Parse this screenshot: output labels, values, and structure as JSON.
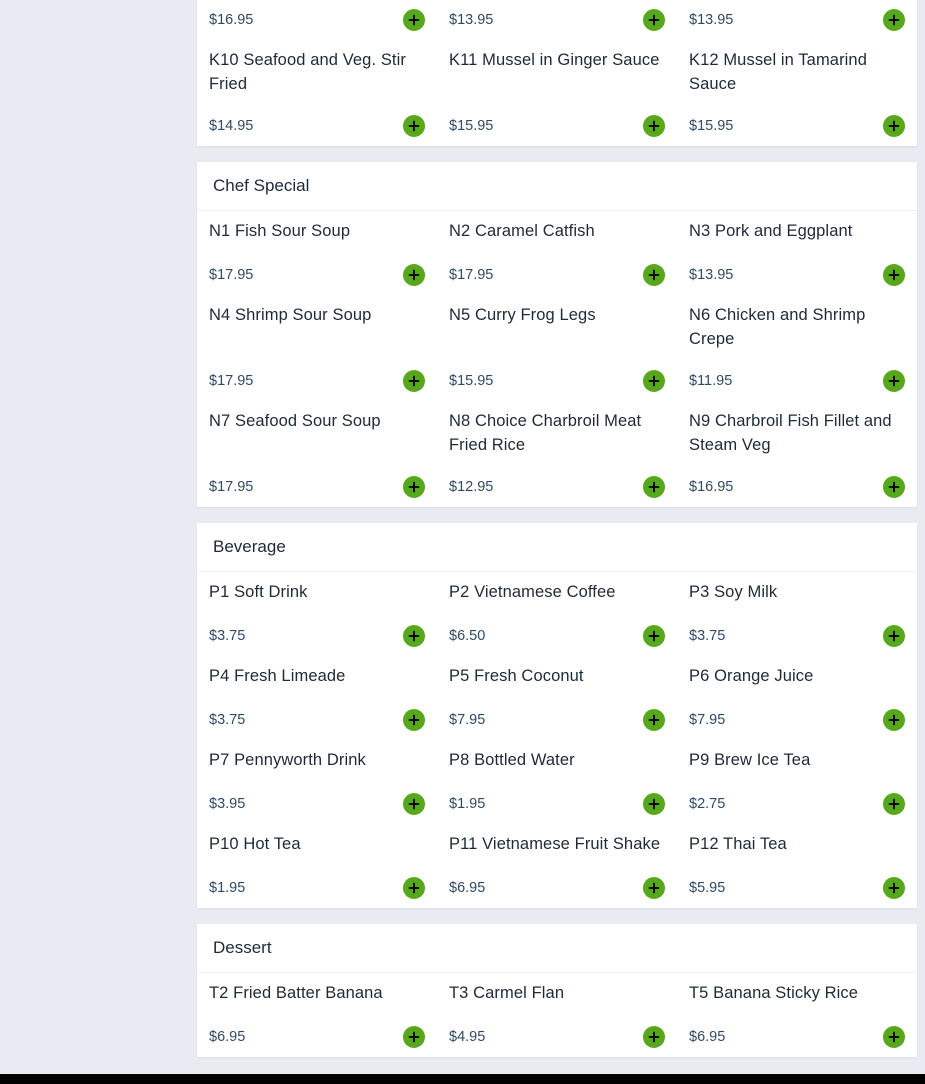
{
  "colors": {
    "accent": "#58a81c",
    "background": "#e8ebf1",
    "text": "#1e2a36",
    "price": "#2f4a66"
  },
  "top_partial": {
    "rows": [
      [
        {
          "price": "$16.95"
        },
        {
          "price": "$13.95"
        },
        {
          "price": "$13.95"
        }
      ],
      [
        {
          "name": "K10 Seafood and Veg. Stir Fried",
          "price": "$14.95"
        },
        {
          "name": "K11 Mussel in Ginger Sauce",
          "price": "$15.95"
        },
        {
          "name": "K12 Mussel in Tamarind Sauce",
          "price": "$15.95"
        }
      ]
    ]
  },
  "sections": [
    {
      "title": "Chef Special",
      "items": [
        {
          "name": "N1 Fish Sour Soup",
          "price": "$17.95"
        },
        {
          "name": "N2 Caramel Catfish",
          "price": "$17.95"
        },
        {
          "name": "N3 Pork and Eggplant",
          "price": "$13.95"
        },
        {
          "name": "N4 Shrimp Sour Soup",
          "price": "$17.95"
        },
        {
          "name": "N5 Curry Frog Legs",
          "price": "$15.95"
        },
        {
          "name": "N6 Chicken and Shrimp Crepe",
          "price": "$11.95"
        },
        {
          "name": "N7 Seafood Sour Soup",
          "price": "$17.95"
        },
        {
          "name": "N8 Choice Charbroil Meat Fried Rice",
          "price": "$12.95"
        },
        {
          "name": "N9 Charbroil Fish Fillet and Steam Veg",
          "price": "$16.95"
        }
      ]
    },
    {
      "title": "Beverage",
      "items": [
        {
          "name": "P1 Soft Drink",
          "price": "$3.75"
        },
        {
          "name": "P2 Vietnamese Coffee",
          "price": "$6.50"
        },
        {
          "name": "P3 Soy Milk",
          "price": "$3.75"
        },
        {
          "name": "P4 Fresh Limeade",
          "price": "$3.75"
        },
        {
          "name": "P5 Fresh Coconut",
          "price": "$7.95"
        },
        {
          "name": "P6 Orange Juice",
          "price": "$7.95"
        },
        {
          "name": "P7 Pennyworth Drink",
          "price": "$3.95"
        },
        {
          "name": "P8 Bottled Water",
          "price": "$1.95"
        },
        {
          "name": "P9 Brew Ice Tea",
          "price": "$2.75"
        },
        {
          "name": "P10 Hot Tea",
          "price": "$1.95"
        },
        {
          "name": "P11 Vietnamese Fruit Shake",
          "price": "$6.95"
        },
        {
          "name": "P12 Thai Tea",
          "price": "$5.95"
        }
      ]
    },
    {
      "title": "Dessert",
      "items": [
        {
          "name": "T2 Fried Batter Banana",
          "price": "$6.95"
        },
        {
          "name": "T3 Carmel Flan",
          "price": "$4.95"
        },
        {
          "name": "T5 Banana Sticky Rice",
          "price": "$6.95"
        }
      ]
    }
  ]
}
